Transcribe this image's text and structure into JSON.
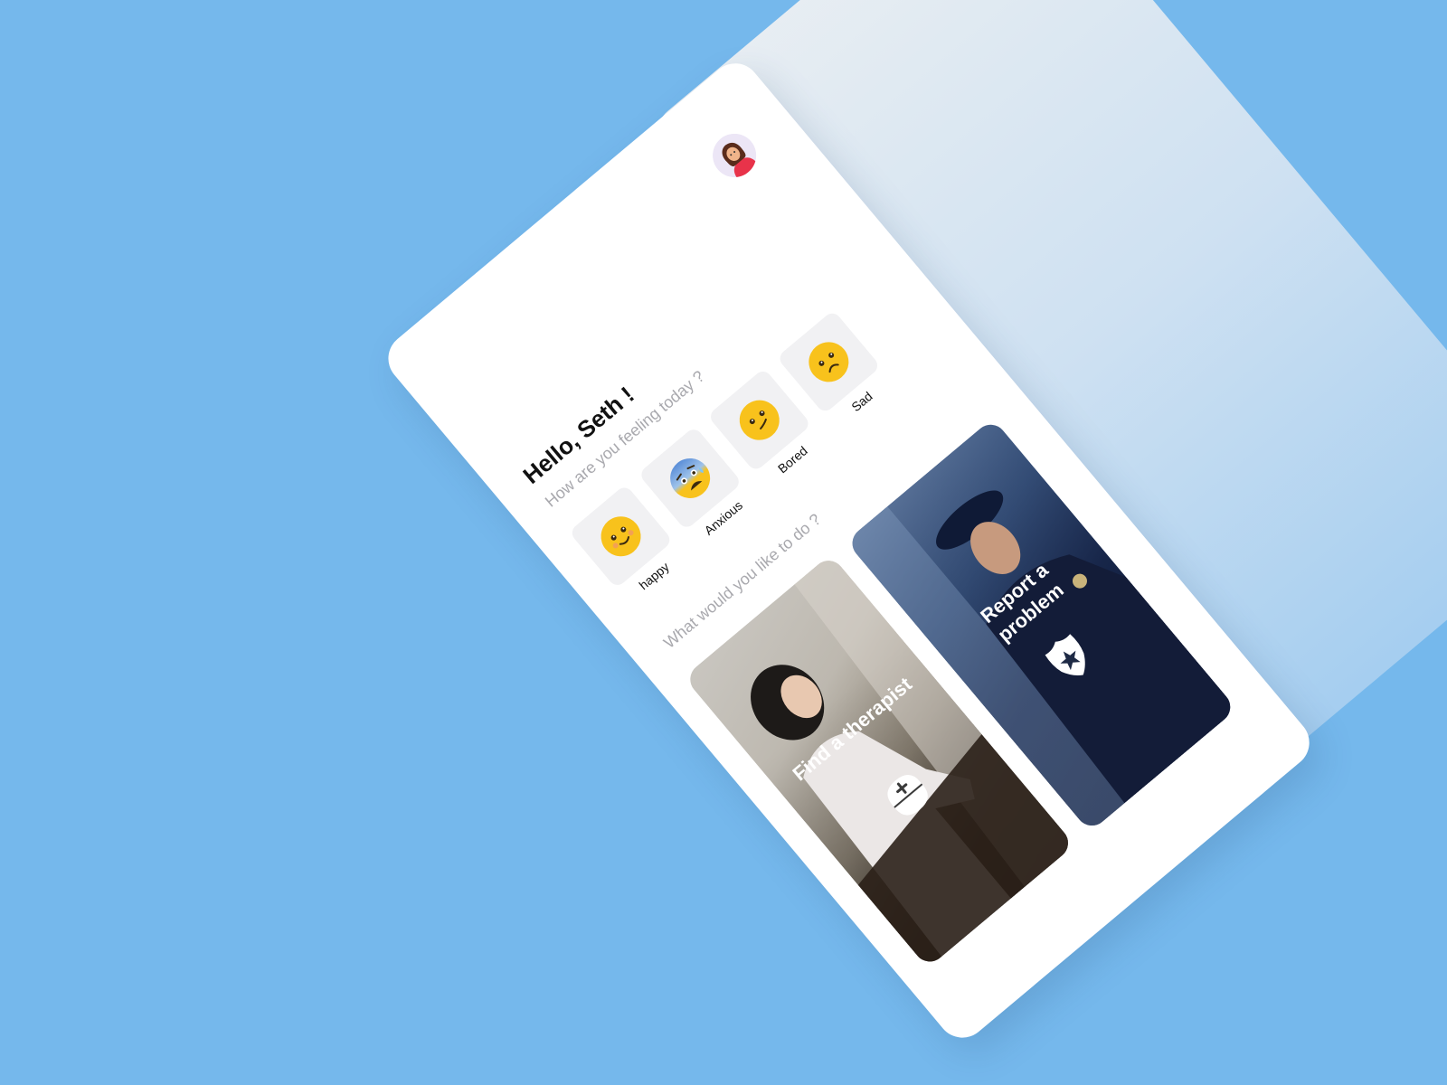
{
  "user": {
    "greeting": "Hello, Seth !"
  },
  "feeling": {
    "question": "How are you feeling today ?",
    "moods": [
      {
        "label": "happy",
        "icon": "happy-face-icon"
      },
      {
        "label": "Anxious",
        "icon": "anxious-face-icon"
      },
      {
        "label": "Bored",
        "icon": "bored-face-icon"
      },
      {
        "label": "Sad",
        "icon": "sad-face-icon"
      }
    ]
  },
  "actions": {
    "question": "What would you like to do ?",
    "cards": [
      {
        "title": "Find a therapist",
        "icon": "medical-cap-icon"
      },
      {
        "title": "Report a problem",
        "icon": "police-badge-icon"
      }
    ]
  },
  "colors": {
    "background": "#75b8ec",
    "card": "#ffffff",
    "muted_text": "#a9a9ae",
    "emoji_yellow": "#f8c21c"
  }
}
